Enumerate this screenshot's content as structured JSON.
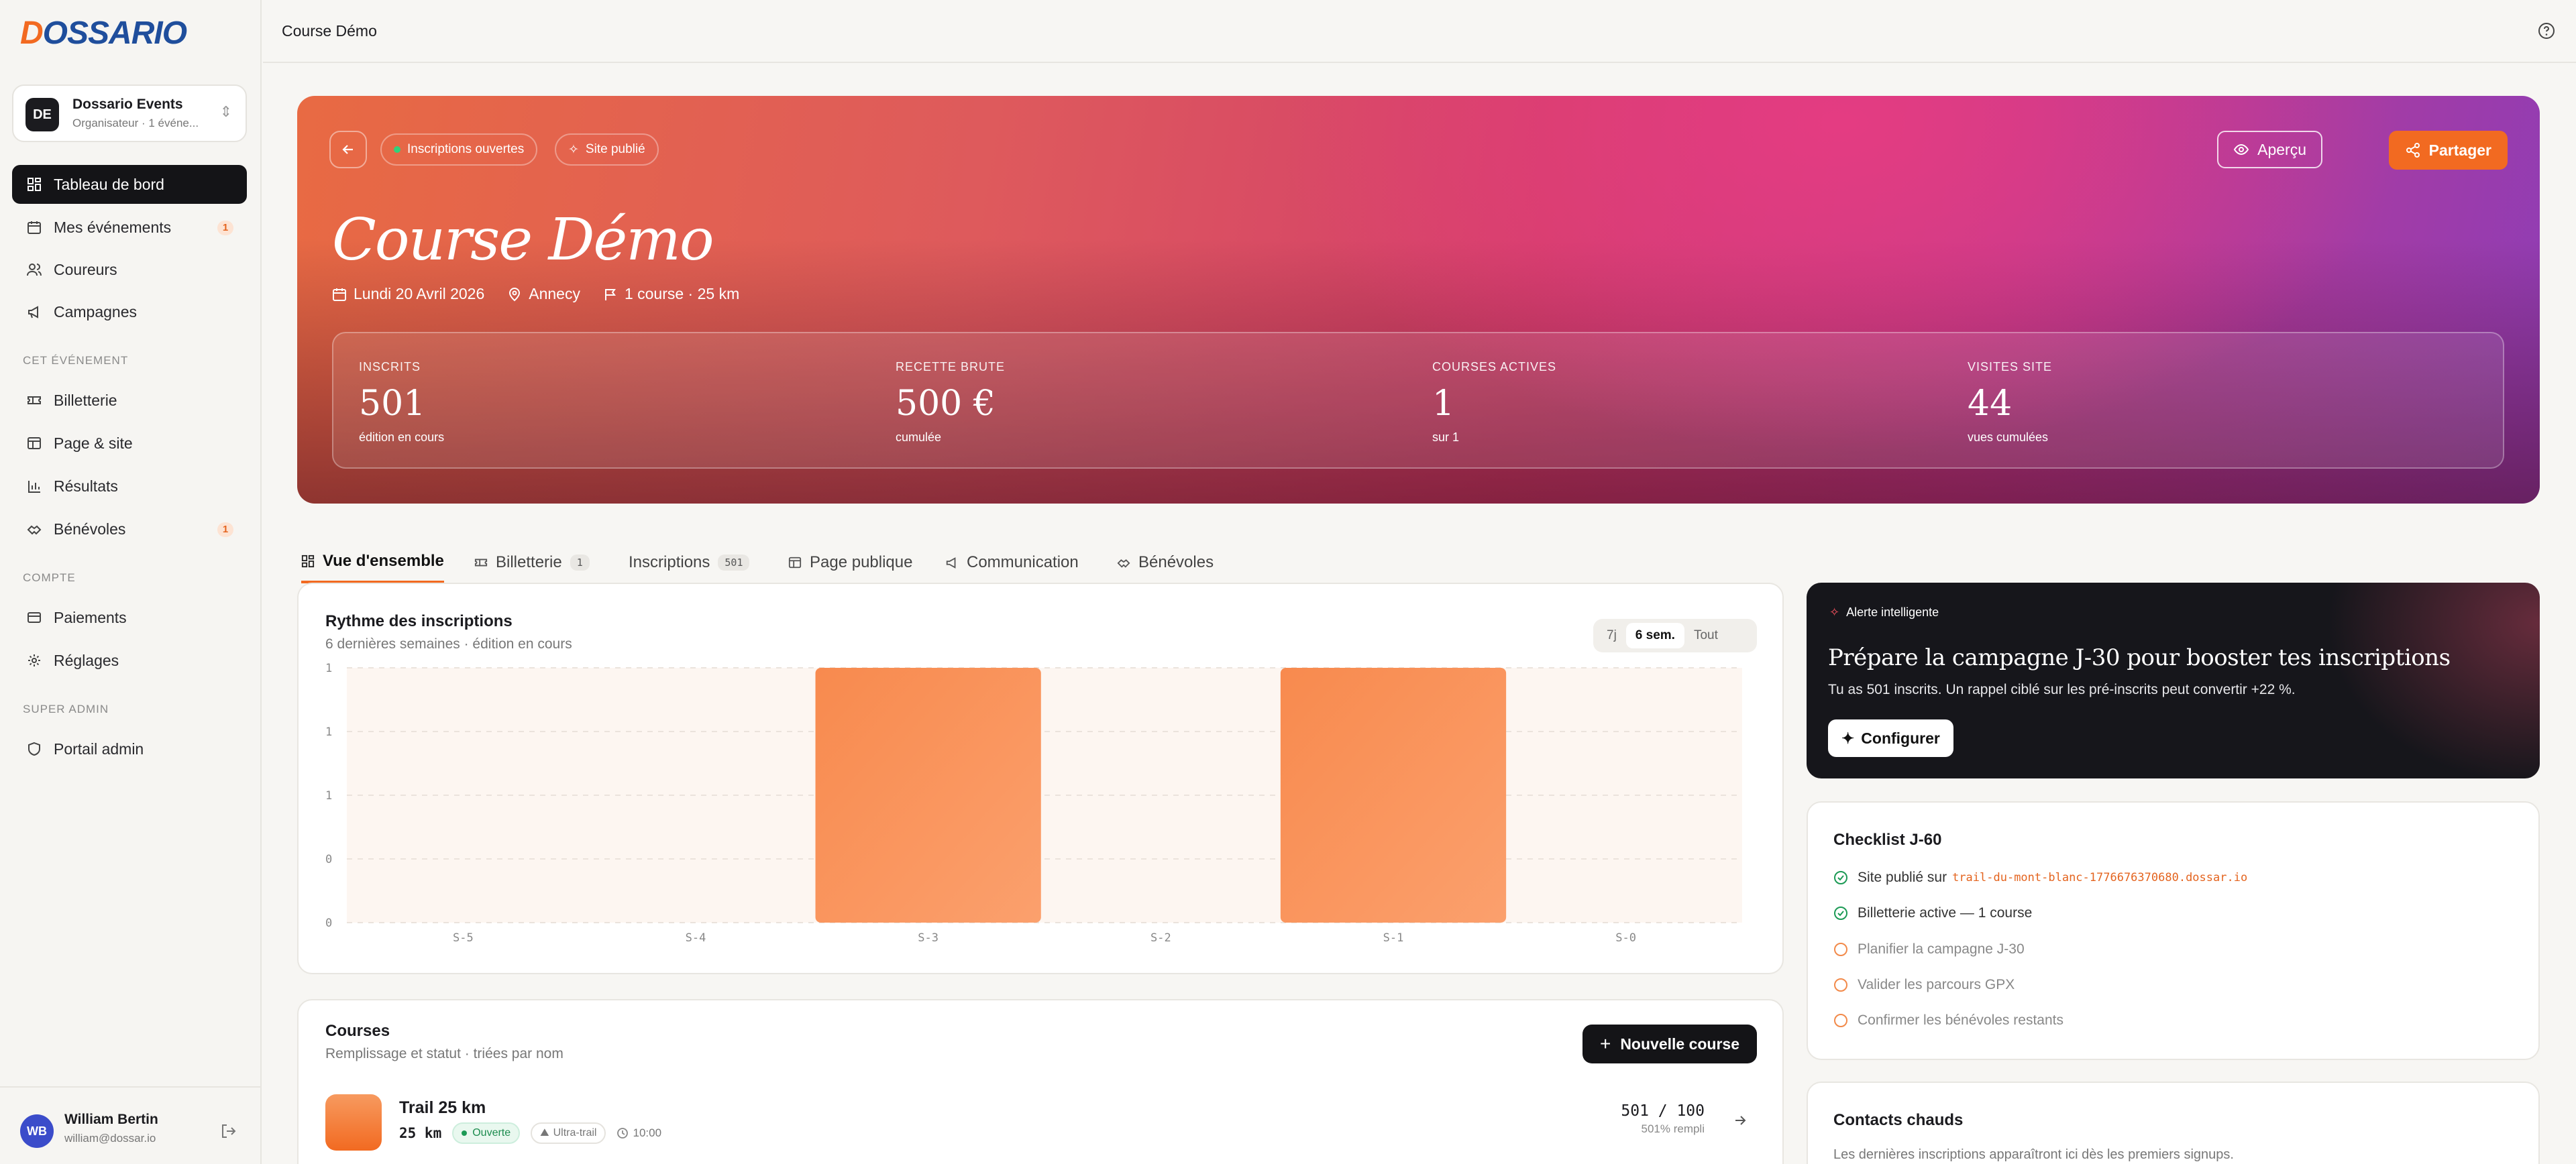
{
  "sidebar": {
    "logo_prefix": "D",
    "logo_rest": "OSSARIO",
    "org": {
      "initials": "DE",
      "name": "Dossario Events",
      "subtitle": "Organisateur · 1 événe..."
    },
    "nav": [
      {
        "label": "Tableau de bord",
        "icon": "dashboard-icon",
        "active": true
      },
      {
        "label": "Mes événements",
        "icon": "calendar-icon",
        "count": "1"
      },
      {
        "label": "Coureurs",
        "icon": "users-icon"
      },
      {
        "label": "Campagnes",
        "icon": "megaphone-icon"
      }
    ],
    "section_event": "CET ÉVÉNEMENT",
    "event_nav": [
      {
        "label": "Billetterie",
        "icon": "ticket-icon"
      },
      {
        "label": "Page & site",
        "icon": "layout-icon"
      },
      {
        "label": "Résultats",
        "icon": "bar-chart-icon"
      },
      {
        "label": "Bénévoles",
        "icon": "handshake-icon",
        "count": "1"
      }
    ],
    "section_account": "COMPTE",
    "account_nav": [
      {
        "label": "Paiements",
        "icon": "credit-card-icon"
      },
      {
        "label": "Réglages",
        "icon": "gear-icon"
      }
    ],
    "section_admin": "SUPER ADMIN",
    "admin_nav": [
      {
        "label": "Portail admin",
        "icon": "shield-icon"
      }
    ],
    "user": {
      "initials": "WB",
      "name": "William Bertin",
      "email": "william@dossar.io"
    }
  },
  "topbar": {
    "title": "Course Démo"
  },
  "hero": {
    "pill_open": "Inscriptions ouvertes",
    "pill_site": "Site publié",
    "preview_label": "Aperçu",
    "share_label": "Partager",
    "title": "Course Démo",
    "date": "Lundi 20 Avril 2026",
    "location": "Annecy",
    "courses": "1 course · 25 km",
    "stats": [
      {
        "label": "INSCRITS",
        "value": "501",
        "sub": "édition en cours"
      },
      {
        "label": "RECETTE BRUTE",
        "value": "500 €",
        "sub": "cumulée"
      },
      {
        "label": "COURSES ACTIVES",
        "value": "1",
        "sub": "sur 1"
      },
      {
        "label": "VISITES SITE",
        "value": "44",
        "sub": "vues cumulées"
      }
    ]
  },
  "tabs": [
    {
      "label": "Vue d'ensemble",
      "active": true
    },
    {
      "label": "Billetterie",
      "count": "1"
    },
    {
      "label": "Inscriptions",
      "count": "501"
    },
    {
      "label": "Page publique"
    },
    {
      "label": "Communication"
    },
    {
      "label": "Bénévoles"
    }
  ],
  "chart_card": {
    "title": "Rythme des inscriptions",
    "subtitle": "6 dernières semaines · édition en cours",
    "ranges": [
      "7j",
      "6 sem.",
      "Tout"
    ],
    "selected_range": "6 sem."
  },
  "chart_data": {
    "type": "bar",
    "title": "Rythme des inscriptions",
    "categories": [
      "S-5",
      "S-4",
      "S-3",
      "S-2",
      "S-1",
      "S-0"
    ],
    "values": [
      0,
      0,
      1,
      0,
      1,
      0
    ],
    "yticks": [
      "1",
      "1",
      "1",
      "0",
      "0"
    ],
    "ylim": [
      0,
      1
    ],
    "bar_color": "#f26a21",
    "grid": true
  },
  "courses_card": {
    "title": "Courses",
    "subtitle": "Remplissage et statut · triées par nom",
    "new_label": "Nouvelle course",
    "items": [
      {
        "name": "Trail 25 km",
        "distance": "25 km",
        "status": "Ouverte",
        "category": "Ultra-trail",
        "time": "10:00",
        "filled": "501 / 100",
        "rate": "501% rempli"
      }
    ]
  },
  "alert": {
    "tag": "Alerte intelligente",
    "title": "Prépare la campagne J-30 pour booster tes inscriptions",
    "text": "Tu as 501 inscrits. Un rappel ciblé sur les pré-inscrits peut convertir +22 %.",
    "button": "Configurer"
  },
  "checklist": {
    "title": "Checklist J-60",
    "items": [
      {
        "label": "Site publié sur",
        "code": "trail-du-mont-blanc-1776676370680.dossar.io",
        "done": true
      },
      {
        "label": "Billetterie active — 1 course",
        "done": true
      },
      {
        "label": "Planifier la campagne J-30",
        "done": false
      },
      {
        "label": "Valider les parcours GPX",
        "done": false
      },
      {
        "label": "Confirmer les bénévoles restants",
        "done": false
      }
    ]
  },
  "contacts": {
    "title": "Contacts chauds",
    "text": "Les dernières inscriptions apparaîtront ici dès les premiers signups."
  },
  "colors": {
    "accent": "#f26a21",
    "dark": "#141417",
    "success": "#1c9a55"
  }
}
